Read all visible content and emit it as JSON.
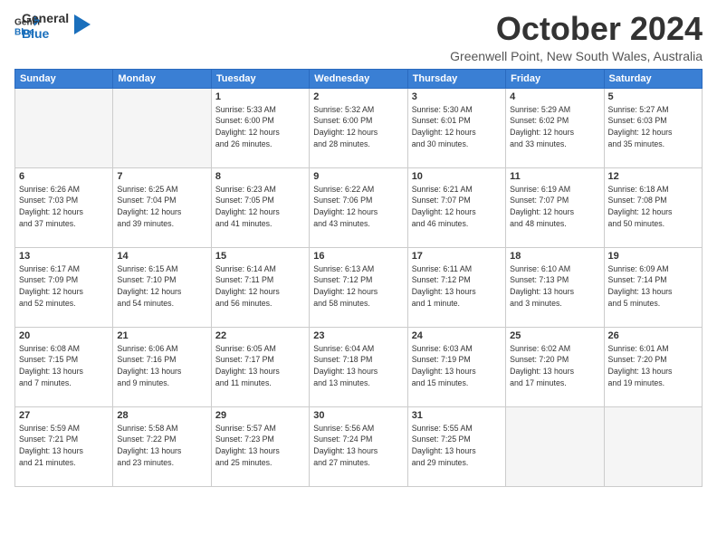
{
  "logo": {
    "line1": "General",
    "line2": "Blue"
  },
  "title": "October 2024",
  "subtitle": "Greenwell Point, New South Wales, Australia",
  "days_header": [
    "Sunday",
    "Monday",
    "Tuesday",
    "Wednesday",
    "Thursday",
    "Friday",
    "Saturday"
  ],
  "weeks": [
    [
      {
        "day": "",
        "info": ""
      },
      {
        "day": "",
        "info": ""
      },
      {
        "day": "1",
        "info": "Sunrise: 5:33 AM\nSunset: 6:00 PM\nDaylight: 12 hours\nand 26 minutes."
      },
      {
        "day": "2",
        "info": "Sunrise: 5:32 AM\nSunset: 6:00 PM\nDaylight: 12 hours\nand 28 minutes."
      },
      {
        "day": "3",
        "info": "Sunrise: 5:30 AM\nSunset: 6:01 PM\nDaylight: 12 hours\nand 30 minutes."
      },
      {
        "day": "4",
        "info": "Sunrise: 5:29 AM\nSunset: 6:02 PM\nDaylight: 12 hours\nand 33 minutes."
      },
      {
        "day": "5",
        "info": "Sunrise: 5:27 AM\nSunset: 6:03 PM\nDaylight: 12 hours\nand 35 minutes."
      }
    ],
    [
      {
        "day": "6",
        "info": "Sunrise: 6:26 AM\nSunset: 7:03 PM\nDaylight: 12 hours\nand 37 minutes."
      },
      {
        "day": "7",
        "info": "Sunrise: 6:25 AM\nSunset: 7:04 PM\nDaylight: 12 hours\nand 39 minutes."
      },
      {
        "day": "8",
        "info": "Sunrise: 6:23 AM\nSunset: 7:05 PM\nDaylight: 12 hours\nand 41 minutes."
      },
      {
        "day": "9",
        "info": "Sunrise: 6:22 AM\nSunset: 7:06 PM\nDaylight: 12 hours\nand 43 minutes."
      },
      {
        "day": "10",
        "info": "Sunrise: 6:21 AM\nSunset: 7:07 PM\nDaylight: 12 hours\nand 46 minutes."
      },
      {
        "day": "11",
        "info": "Sunrise: 6:19 AM\nSunset: 7:07 PM\nDaylight: 12 hours\nand 48 minutes."
      },
      {
        "day": "12",
        "info": "Sunrise: 6:18 AM\nSunset: 7:08 PM\nDaylight: 12 hours\nand 50 minutes."
      }
    ],
    [
      {
        "day": "13",
        "info": "Sunrise: 6:17 AM\nSunset: 7:09 PM\nDaylight: 12 hours\nand 52 minutes."
      },
      {
        "day": "14",
        "info": "Sunrise: 6:15 AM\nSunset: 7:10 PM\nDaylight: 12 hours\nand 54 minutes."
      },
      {
        "day": "15",
        "info": "Sunrise: 6:14 AM\nSunset: 7:11 PM\nDaylight: 12 hours\nand 56 minutes."
      },
      {
        "day": "16",
        "info": "Sunrise: 6:13 AM\nSunset: 7:12 PM\nDaylight: 12 hours\nand 58 minutes."
      },
      {
        "day": "17",
        "info": "Sunrise: 6:11 AM\nSunset: 7:12 PM\nDaylight: 13 hours\nand 1 minute."
      },
      {
        "day": "18",
        "info": "Sunrise: 6:10 AM\nSunset: 7:13 PM\nDaylight: 13 hours\nand 3 minutes."
      },
      {
        "day": "19",
        "info": "Sunrise: 6:09 AM\nSunset: 7:14 PM\nDaylight: 13 hours\nand 5 minutes."
      }
    ],
    [
      {
        "day": "20",
        "info": "Sunrise: 6:08 AM\nSunset: 7:15 PM\nDaylight: 13 hours\nand 7 minutes."
      },
      {
        "day": "21",
        "info": "Sunrise: 6:06 AM\nSunset: 7:16 PM\nDaylight: 13 hours\nand 9 minutes."
      },
      {
        "day": "22",
        "info": "Sunrise: 6:05 AM\nSunset: 7:17 PM\nDaylight: 13 hours\nand 11 minutes."
      },
      {
        "day": "23",
        "info": "Sunrise: 6:04 AM\nSunset: 7:18 PM\nDaylight: 13 hours\nand 13 minutes."
      },
      {
        "day": "24",
        "info": "Sunrise: 6:03 AM\nSunset: 7:19 PM\nDaylight: 13 hours\nand 15 minutes."
      },
      {
        "day": "25",
        "info": "Sunrise: 6:02 AM\nSunset: 7:20 PM\nDaylight: 13 hours\nand 17 minutes."
      },
      {
        "day": "26",
        "info": "Sunrise: 6:01 AM\nSunset: 7:20 PM\nDaylight: 13 hours\nand 19 minutes."
      }
    ],
    [
      {
        "day": "27",
        "info": "Sunrise: 5:59 AM\nSunset: 7:21 PM\nDaylight: 13 hours\nand 21 minutes."
      },
      {
        "day": "28",
        "info": "Sunrise: 5:58 AM\nSunset: 7:22 PM\nDaylight: 13 hours\nand 23 minutes."
      },
      {
        "day": "29",
        "info": "Sunrise: 5:57 AM\nSunset: 7:23 PM\nDaylight: 13 hours\nand 25 minutes."
      },
      {
        "day": "30",
        "info": "Sunrise: 5:56 AM\nSunset: 7:24 PM\nDaylight: 13 hours\nand 27 minutes."
      },
      {
        "day": "31",
        "info": "Sunrise: 5:55 AM\nSunset: 7:25 PM\nDaylight: 13 hours\nand 29 minutes."
      },
      {
        "day": "",
        "info": ""
      },
      {
        "day": "",
        "info": ""
      }
    ]
  ]
}
